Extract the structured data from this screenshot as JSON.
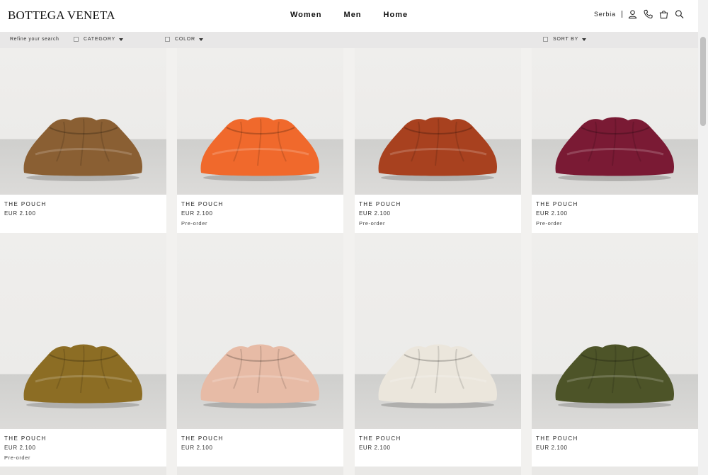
{
  "header": {
    "logo": "BOTTEGA VENETA",
    "nav": [
      "Women",
      "Men",
      "Home"
    ],
    "country": "Serbia"
  },
  "filters": {
    "refine_label": "Refine your search",
    "category": "CATEGORY",
    "color": "COLOR",
    "sort": "SORT BY"
  },
  "products": [
    {
      "name": "THE POUCH",
      "price": "EUR 2.100",
      "status": "",
      "color": "#8a5f33"
    },
    {
      "name": "THE POUCH",
      "price": "EUR 2.100",
      "status": "Pre-order",
      "color": "#f0692c"
    },
    {
      "name": "THE POUCH",
      "price": "EUR 2.100",
      "status": "Pre-order",
      "color": "#a8411f"
    },
    {
      "name": "THE POUCH",
      "price": "EUR 2.100",
      "status": "Pre-order",
      "color": "#7a1a34"
    },
    {
      "name": "THE POUCH",
      "price": "EUR 2.100",
      "status": "Pre-order",
      "color": "#8c6d24"
    },
    {
      "name": "THE POUCH",
      "price": "EUR 2.100",
      "status": "",
      "color": "#e7bba6"
    },
    {
      "name": "THE POUCH",
      "price": "EUR 2.100",
      "status": "",
      "color": "#ebe6dc"
    },
    {
      "name": "THE POUCH",
      "price": "EUR 2.100",
      "status": "",
      "color": "#4d5428"
    }
  ]
}
